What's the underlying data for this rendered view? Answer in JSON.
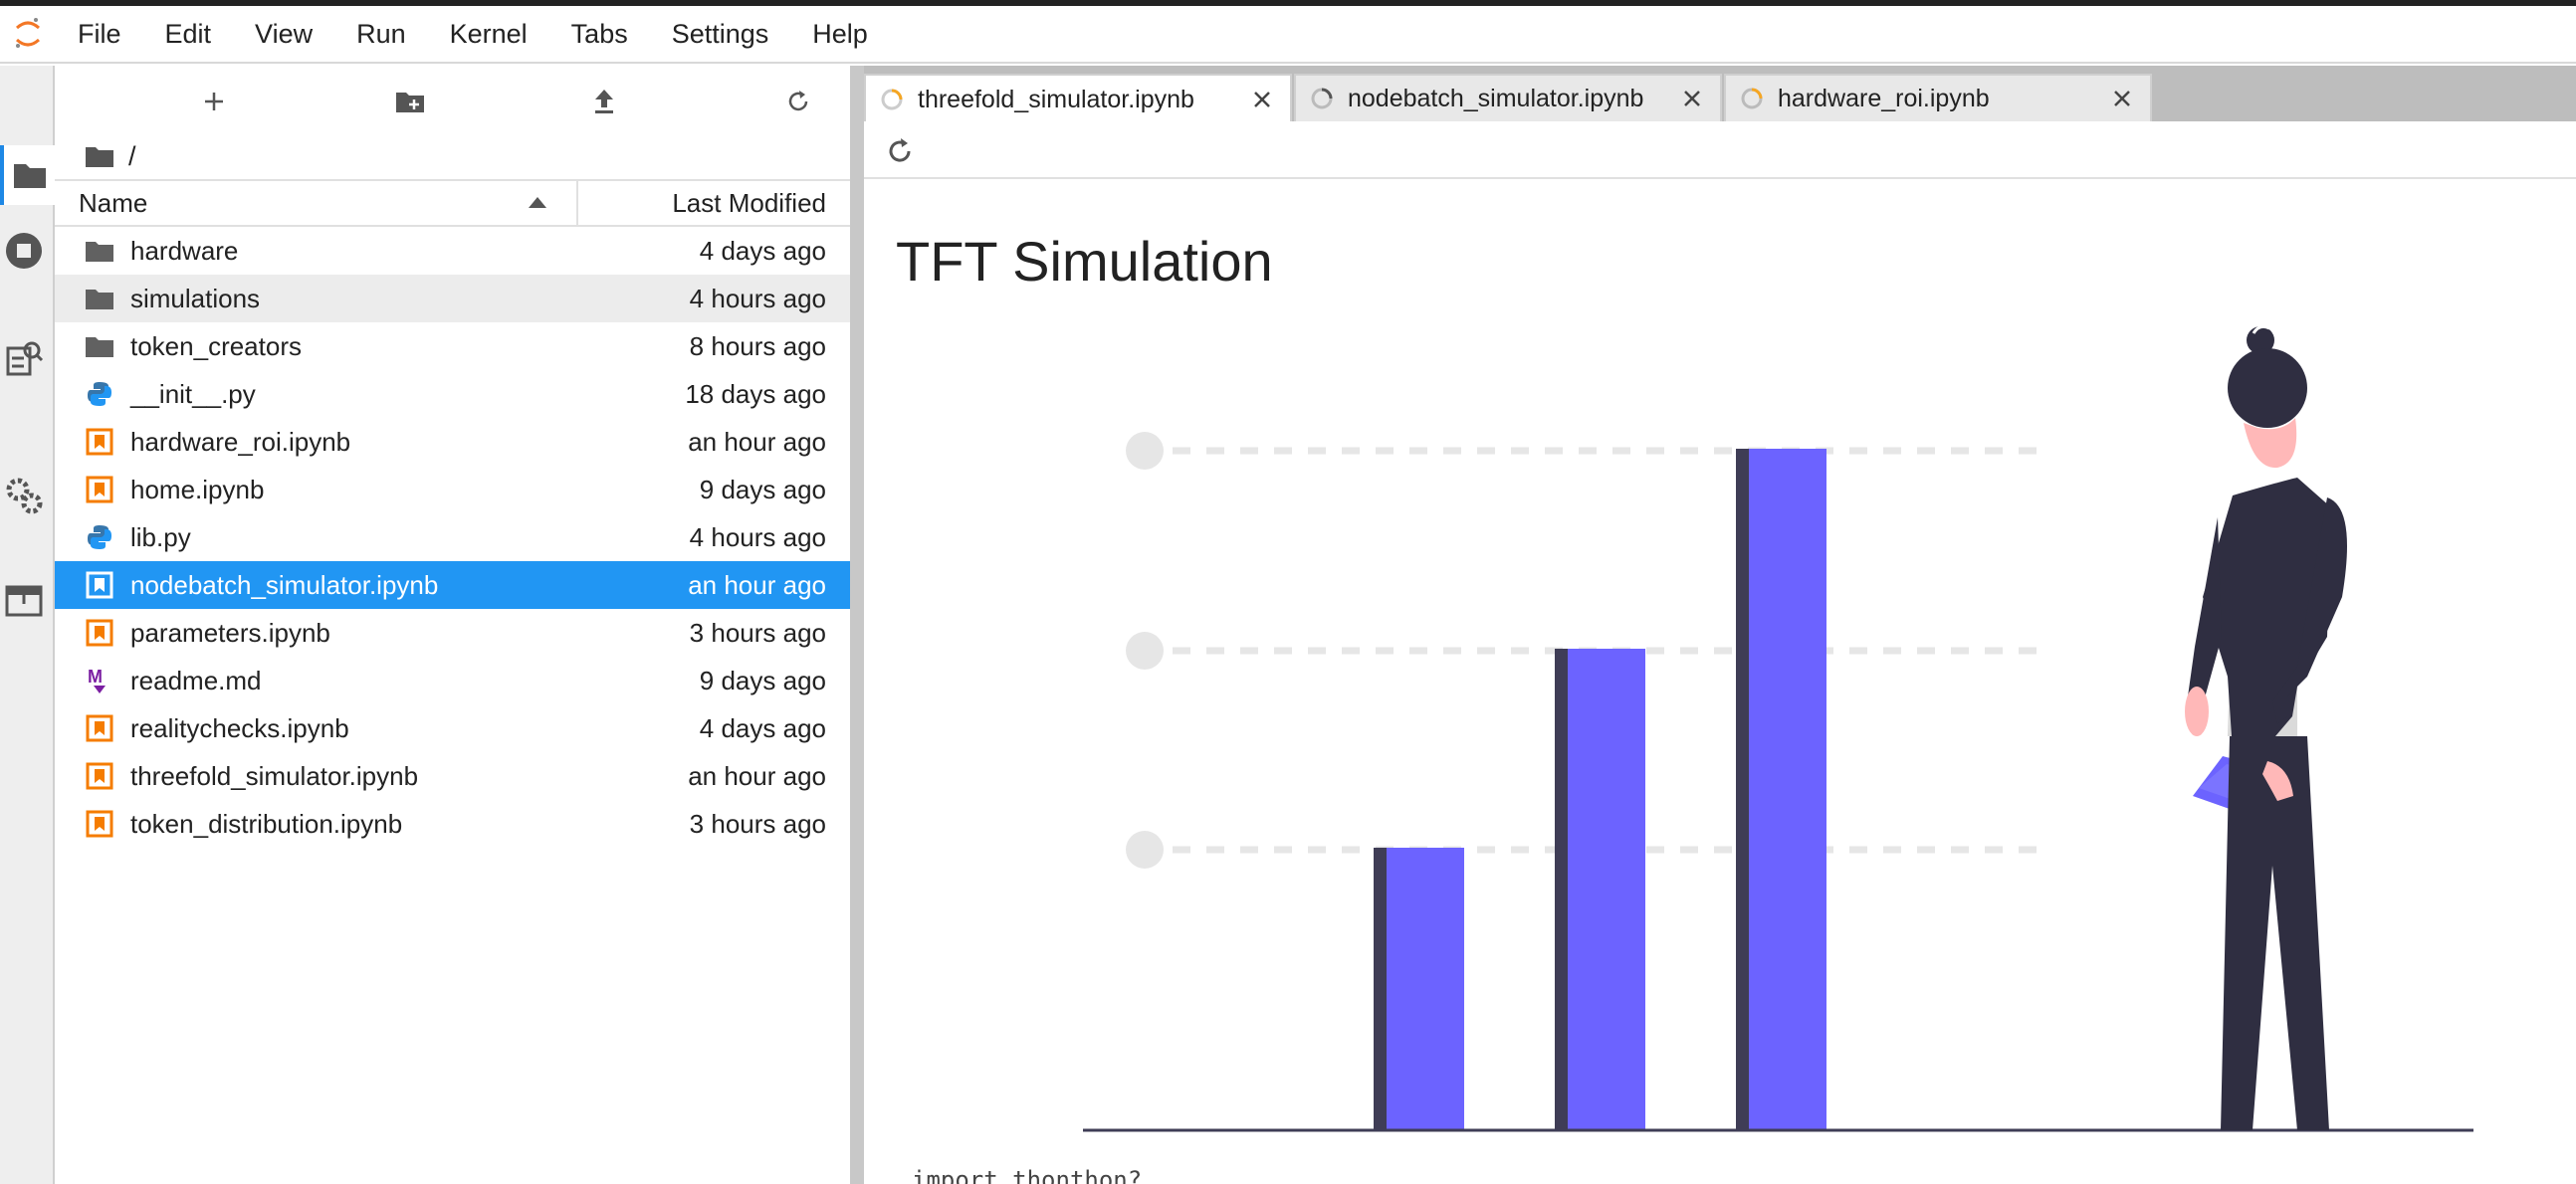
{
  "menu": [
    "File",
    "Edit",
    "View",
    "Run",
    "Kernel",
    "Tabs",
    "Settings",
    "Help"
  ],
  "icons": {
    "logo": "jupyter-logo-icon",
    "activity": [
      "folder-icon",
      "running-icon",
      "commands-icon",
      "settings-icon",
      "tabs-icon"
    ],
    "toolbar": [
      "new-launcher-icon",
      "new-folder-icon",
      "upload-icon",
      "refresh-icon"
    ]
  },
  "file_browser": {
    "breadcrumb": "/",
    "columns": {
      "name": "Name",
      "modified": "Last Modified"
    },
    "files": [
      {
        "name": "hardware",
        "modified": "4 days ago",
        "type": "folder"
      },
      {
        "name": "simulations",
        "modified": "4 hours ago",
        "type": "folder"
      },
      {
        "name": "token_creators",
        "modified": "8 hours ago",
        "type": "folder"
      },
      {
        "name": "__init__.py",
        "modified": "18 days ago",
        "type": "python"
      },
      {
        "name": "hardware_roi.ipynb",
        "modified": "an hour ago",
        "type": "notebook"
      },
      {
        "name": "home.ipynb",
        "modified": "9 days ago",
        "type": "notebook"
      },
      {
        "name": "lib.py",
        "modified": "4 hours ago",
        "type": "python"
      },
      {
        "name": "nodebatch_simulator.ipynb",
        "modified": "an hour ago",
        "type": "notebook"
      },
      {
        "name": "parameters.ipynb",
        "modified": "3 hours ago",
        "type": "notebook"
      },
      {
        "name": "readme.md",
        "modified": "9 days ago",
        "type": "markdown"
      },
      {
        "name": "realitychecks.ipynb",
        "modified": "4 days ago",
        "type": "notebook"
      },
      {
        "name": "threefold_simulator.ipynb",
        "modified": "an hour ago",
        "type": "notebook"
      },
      {
        "name": "token_distribution.ipynb",
        "modified": "3 hours ago",
        "type": "notebook"
      }
    ],
    "selected": "nodebatch_simulator.ipynb",
    "hovered": "simulations"
  },
  "tabs": [
    {
      "label": "threefold_simulator.ipynb",
      "active": true
    },
    {
      "label": "nodebatch_simulator.ipynb",
      "active": false
    },
    {
      "label": "hardware_roi.ipynb",
      "active": false
    }
  ],
  "notebook": {
    "title": "TFT Simulation",
    "partial_code": "import thonthon?"
  },
  "colors": {
    "accent": "#2196f3",
    "bar_purple": "#6c63ff",
    "bar_dark": "#3f3d56",
    "notebook_orange": "#f57c00",
    "python_blue": "#3776ab",
    "markdown_purple": "#7b1fa2"
  }
}
